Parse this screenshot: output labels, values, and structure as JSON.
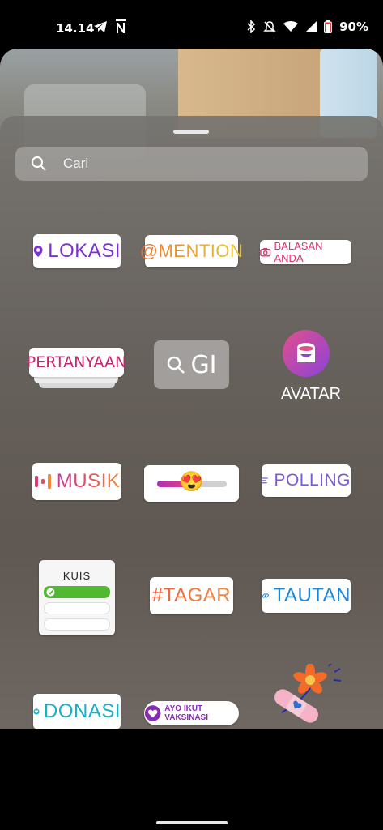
{
  "status_bar": {
    "time": "14.14",
    "battery": "90%"
  },
  "search": {
    "placeholder": "Cari"
  },
  "stickers": {
    "lokasi": "LOKASI",
    "mention": "@MENTION",
    "balasan": "BALASAN ANDA",
    "pertanyaan": "PERTANYAAN",
    "gif": "GI",
    "avatar": "AVATAR",
    "musik": "MUSIK",
    "polling": "POLLING",
    "kuis": "KUIS",
    "tagar": "#TAGAR",
    "tautan": "TAUTAN",
    "donasi": "DONASI",
    "vaksinasi": "AYO IKUT VAKSINASI"
  },
  "slider_emoji": "😍",
  "colors": {
    "sheet_handle": "#e9e9e9",
    "kuis_correct": "#51b831"
  }
}
